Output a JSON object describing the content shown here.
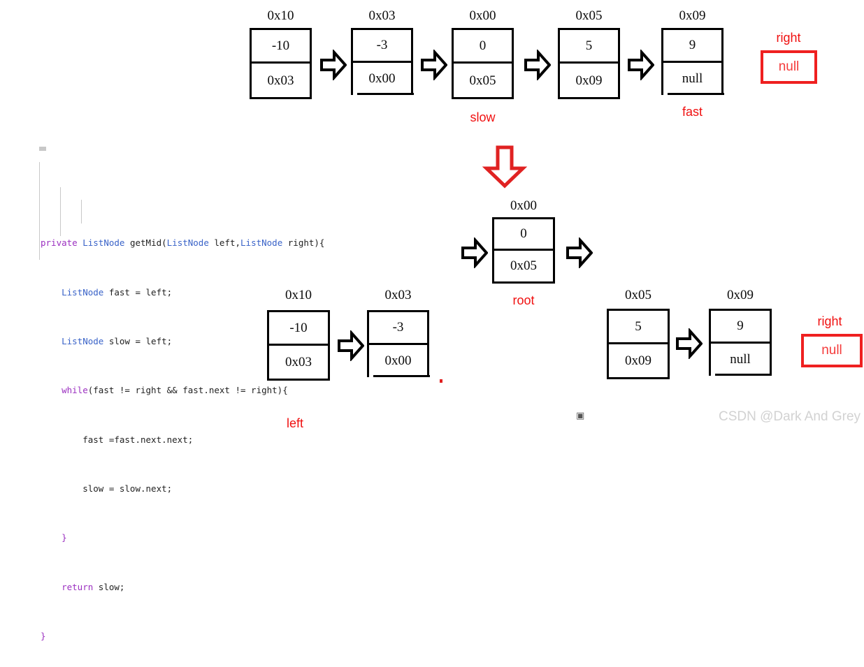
{
  "diagram": {
    "title_context": "getMid linked list fast/slow pointer walkthrough",
    "colors": {
      "node_border": "#000000",
      "text": "#0b0b0b",
      "pointer_red": "#f01010",
      "null_box_border": "#ef2020",
      "arrow_red": "#e02020",
      "watermark": "#d2d2d2"
    },
    "top_row": {
      "nodes": [
        {
          "addr": "0x10",
          "value": "-10",
          "next": "0x03"
        },
        {
          "addr": "0x03",
          "value": "-3",
          "next": "0x00"
        },
        {
          "addr": "0x00",
          "value": "0",
          "next": "0x05"
        },
        {
          "addr": "0x05",
          "value": "5",
          "next": "0x09"
        },
        {
          "addr": "0x09",
          "value": "9",
          "next": "null"
        }
      ],
      "pointer_labels": [
        {
          "name": "slow",
          "target_addr": "0x00"
        },
        {
          "name": "fast",
          "target_addr": "0x09"
        },
        {
          "name": "right",
          "target_addr": "null"
        }
      ],
      "right_null_label": "right",
      "right_null_value": "null"
    },
    "middle_row": {
      "node": {
        "addr": "0x00",
        "value": "0",
        "next": "0x05"
      },
      "label": "root",
      "red_arrow": "down-arrow-red"
    },
    "bottom_left": {
      "nodes": [
        {
          "addr": "0x10",
          "value": "-10",
          "next": "0x03"
        },
        {
          "addr": "0x03",
          "value": "-3",
          "next": "0x00"
        }
      ],
      "label": "left"
    },
    "bottom_right": {
      "nodes": [
        {
          "addr": "0x05",
          "value": "5",
          "next": "0x09"
        },
        {
          "addr": "0x09",
          "value": "9",
          "next": "null"
        }
      ],
      "right_null_label": "right",
      "right_null_value": "null"
    }
  },
  "code": {
    "language": "java",
    "lines": [
      "private ListNode getMid(ListNode left,ListNode right){",
      "    ListNode fast = left;",
      "    ListNode slow = left;",
      "    while(fast != right && fast.next != right){",
      "        fast =fast.next.next;",
      "        slow = slow.next;",
      "    }",
      "    return slow;",
      "}"
    ],
    "tokens": {
      "l1": {
        "a": "private",
        "b": " ",
        "c": "ListNode",
        "d": " ",
        "e": "getMid",
        "f": "(",
        "g": "ListNode",
        "h": " left,",
        "i": "ListNode",
        "j": " right){"
      },
      "l2": {
        "indent": "    ",
        "type": "ListNode",
        "rest": " fast = left;"
      },
      "l3": {
        "indent": "    ",
        "type": "ListNode",
        "rest": " slow = left;"
      },
      "l4": {
        "indent": "    ",
        "kw": "while",
        "rest": "(fast != right && fast.next != right){"
      },
      "l5": {
        "text": "        fast =fast.next.next;"
      },
      "l6": {
        "text": "        slow = slow.next;"
      },
      "l7": {
        "text": "    }"
      },
      "l8": {
        "indent": "    ",
        "kw": "return",
        "rest": " slow;"
      },
      "l9": {
        "text": "}"
      }
    }
  },
  "watermark": {
    "text": "CSDN @Dark And Grey"
  },
  "misc": {
    "placeholder_glyph": "▣"
  }
}
